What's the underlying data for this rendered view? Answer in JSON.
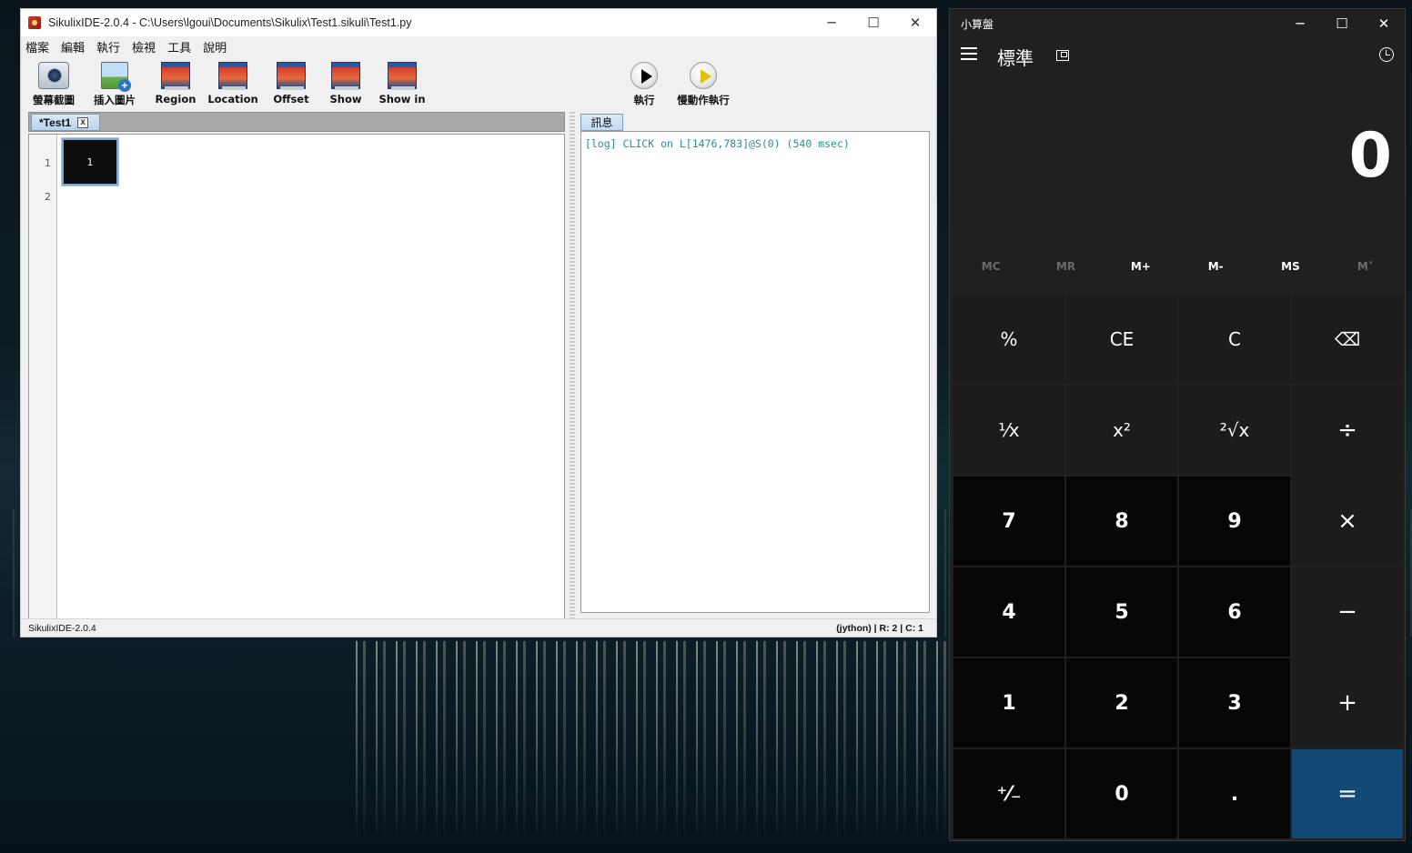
{
  "sikulix": {
    "title": "SikulixIDE-2.0.4 - C:\\Users\\lgoui\\Documents\\Sikulix\\Test1.sikuli\\Test1.py",
    "menu": [
      "檔案",
      "編輯",
      "執行",
      "檢視",
      "工具",
      "說明"
    ],
    "toolbar": {
      "screenshot": "螢幕截圖",
      "insert_image": "插入圖片",
      "region": "Region",
      "location": "Location",
      "offset": "Offset",
      "show": "Show",
      "show_in": "Show in",
      "run": "執行",
      "run_slow": "慢動作執行"
    },
    "editor": {
      "tab_label": "*Test1",
      "tab_close": "x",
      "lines": [
        "1",
        "2"
      ],
      "image_thumb_text": "1"
    },
    "message": {
      "tab_label": "訊息",
      "log": "[log] CLICK on L[1476,783]@S(0) (540 msec)"
    },
    "status": {
      "left": "SikulixIDE-2.0.4",
      "right": "(jython) | R: 2 | C: 1"
    }
  },
  "calculator": {
    "title": "小算盤",
    "mode": "標準",
    "display": "0",
    "memory": [
      {
        "label": "MC",
        "enabled": false
      },
      {
        "label": "MR",
        "enabled": false
      },
      {
        "label": "M+",
        "enabled": true
      },
      {
        "label": "M-",
        "enabled": true
      },
      {
        "label": "MS",
        "enabled": true
      },
      {
        "label": "M˅",
        "enabled": false
      }
    ],
    "keys": {
      "percent": "%",
      "ce": "CE",
      "c": "C",
      "backspace": "⌫",
      "reciprocal": "¹⁄x",
      "square": "x²",
      "sqrt": "²√x",
      "divide": "÷",
      "seven": "7",
      "eight": "8",
      "nine": "9",
      "multiply": "×",
      "four": "4",
      "five": "5",
      "six": "6",
      "minus": "−",
      "one": "1",
      "two": "2",
      "three": "3",
      "plus": "+",
      "negate": "⁺⁄₋",
      "zero": "0",
      "decimal": ".",
      "equals": "="
    }
  }
}
